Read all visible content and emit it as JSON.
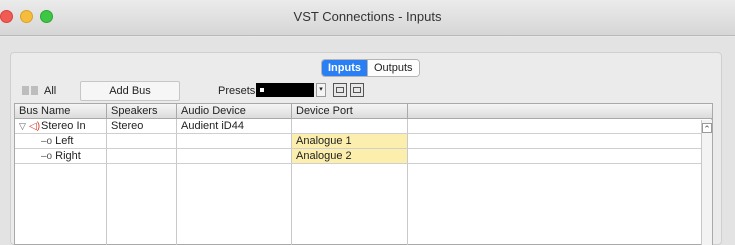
{
  "window": {
    "title": "VST Connections - Inputs"
  },
  "tabs": [
    {
      "label": "Inputs",
      "active": true
    },
    {
      "label": "Outputs",
      "active": false
    }
  ],
  "toolbar": {
    "all_label": "All",
    "add_bus_label": "Add Bus",
    "presets_label": "Presets"
  },
  "table": {
    "columns": [
      "Bus Name",
      "Speakers",
      "Audio Device",
      "Device Port"
    ],
    "rows": [
      {
        "bus_name": "Stereo In",
        "speakers": "Stereo",
        "audio_device": "Audient iD44",
        "device_port": "",
        "type": "bus"
      },
      {
        "bus_name": "Left",
        "speakers": "",
        "audio_device": "",
        "device_port": "Analogue 1",
        "type": "channel"
      },
      {
        "bus_name": "Right",
        "speakers": "",
        "audio_device": "",
        "device_port": "Analogue 2",
        "type": "channel"
      }
    ]
  },
  "icons": {
    "expander": "disclosure-triangle-icon",
    "bus": "speaker-icon",
    "channel": "channel-connector-icon",
    "save_preset": "save-preset-icon",
    "remove_preset": "remove-preset-icon",
    "scroll_up": "scroll-up-icon"
  },
  "colors": {
    "active_tab": "#2a7ff5",
    "device_port_highlight": "#fcefae",
    "close": "#f25b53",
    "minimize": "#f6bd3b",
    "zoom": "#3ec645"
  }
}
